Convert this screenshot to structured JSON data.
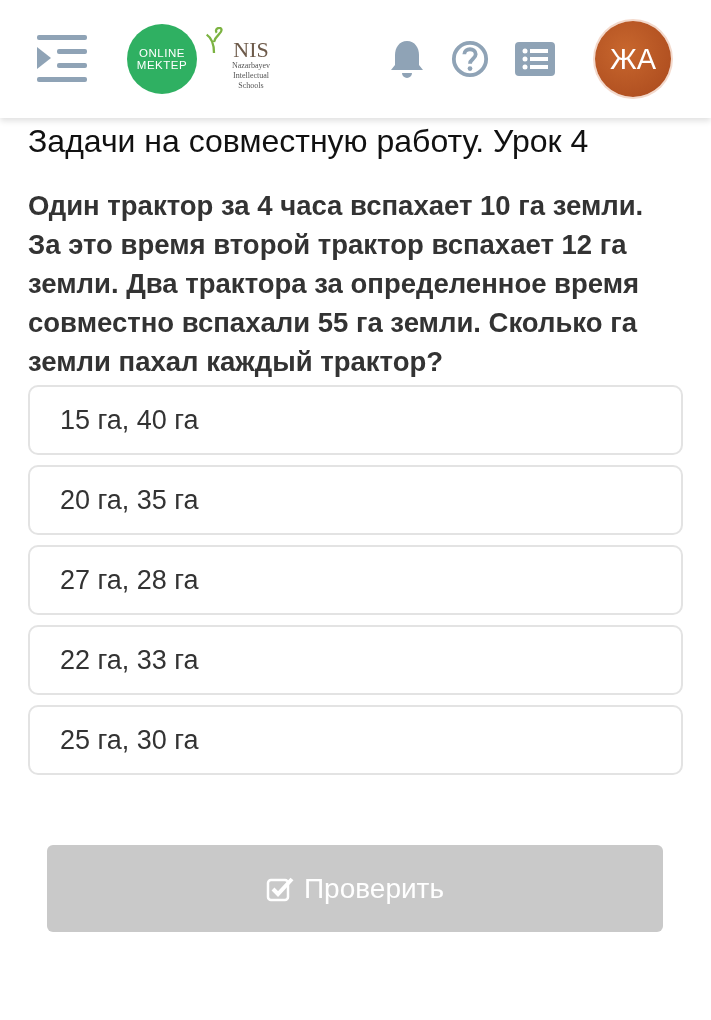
{
  "header": {
    "logo_text": "ONLINE MEKTEP",
    "nis_logo": {
      "name": "NIS",
      "subtitle": "Nazarbayev Intellectual Schools"
    },
    "avatar": "ЖА"
  },
  "title": "Задачи на совместную работу. Урок 4",
  "question": "Один трактор за 4 часа вспахает 10 га земли. За это время второй трактор вспахает 12 га земли. Два трактора за определенное время совместно вспахали 55 га земли. Сколько га земли пахал каждый трактор?",
  "options": [
    {
      "label": "15 га, 40 га",
      "selected": false
    },
    {
      "label": "20 га, 35 га",
      "selected": false
    },
    {
      "label": "27 га, 28 га",
      "selected": false
    },
    {
      "label": "22 га, 33 га",
      "selected": false
    },
    {
      "label": "25 га, 30 га",
      "selected": false
    }
  ],
  "check_button": {
    "label": "Проверить",
    "disabled": true
  }
}
